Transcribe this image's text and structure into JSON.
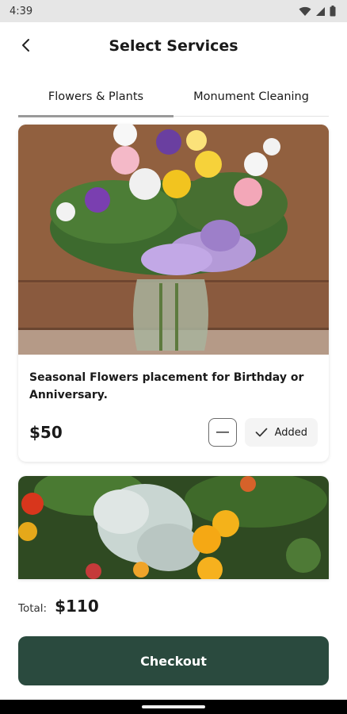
{
  "status_bar": {
    "time": "4:39",
    "icons": [
      "wifi-icon",
      "signal-icon",
      "battery-icon"
    ]
  },
  "header": {
    "title": "Select Services",
    "back_icon": "chevron-left-icon"
  },
  "tabs": [
    {
      "label": "Flowers & Plants",
      "active": true
    },
    {
      "label": "Monument Cleaning",
      "active": false
    }
  ],
  "services": [
    {
      "description": "Seasonal Flowers placement for Birthday or Anniversary.",
      "price": "$50",
      "added_label": "Added",
      "added": true
    },
    {
      "image": "yellow-flowers-and-dusty-miller-planting"
    }
  ],
  "total": {
    "label": "Total:",
    "value": "$110"
  },
  "checkout": {
    "label": "Checkout"
  },
  "colors": {
    "primary": "#2a4a3e",
    "tab_indicator": "#9a9a9a",
    "added_bg": "#f4f4f4"
  }
}
